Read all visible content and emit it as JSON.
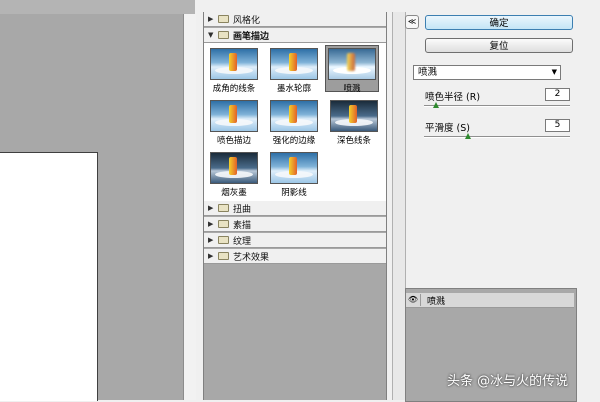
{
  "gallery": {
    "categories_top": [
      {
        "label": "风格化"
      }
    ],
    "open_category": {
      "label": "画笔描边",
      "thumbnails": [
        {
          "label": "成角的线条"
        },
        {
          "label": "墨水轮廓"
        },
        {
          "label": "喷溅"
        },
        {
          "label": "喷色描边"
        },
        {
          "label": "强化的边缘"
        },
        {
          "label": "深色线条"
        },
        {
          "label": "烟灰墨"
        },
        {
          "label": "阴影线"
        }
      ],
      "selected": "喷溅"
    },
    "categories_bottom": [
      {
        "label": "扭曲"
      },
      {
        "label": "素描"
      },
      {
        "label": "纹理"
      },
      {
        "label": "艺术效果"
      }
    ]
  },
  "panel": {
    "ok_label": "确定",
    "reset_label": "复位",
    "filter_select": "喷溅",
    "params": [
      {
        "label": "喷色半径 (R)",
        "value": "2",
        "slider_fraction": 0.08
      },
      {
        "label": "平滑度 (S)",
        "value": "5",
        "slider_fraction": 0.3
      }
    ]
  },
  "layers": {
    "items": [
      {
        "name": "喷溅",
        "visible": true
      }
    ]
  },
  "watermark": "头条 @冰与火的传说",
  "icons": {
    "collapse": "double-chevron-up-icon",
    "eye": "eye-icon",
    "folder": "folder-icon",
    "arrow": "triangle-right-icon"
  },
  "colors": {
    "accent": "#3c7fb1",
    "slider_thumb": "#2f8a2f"
  }
}
